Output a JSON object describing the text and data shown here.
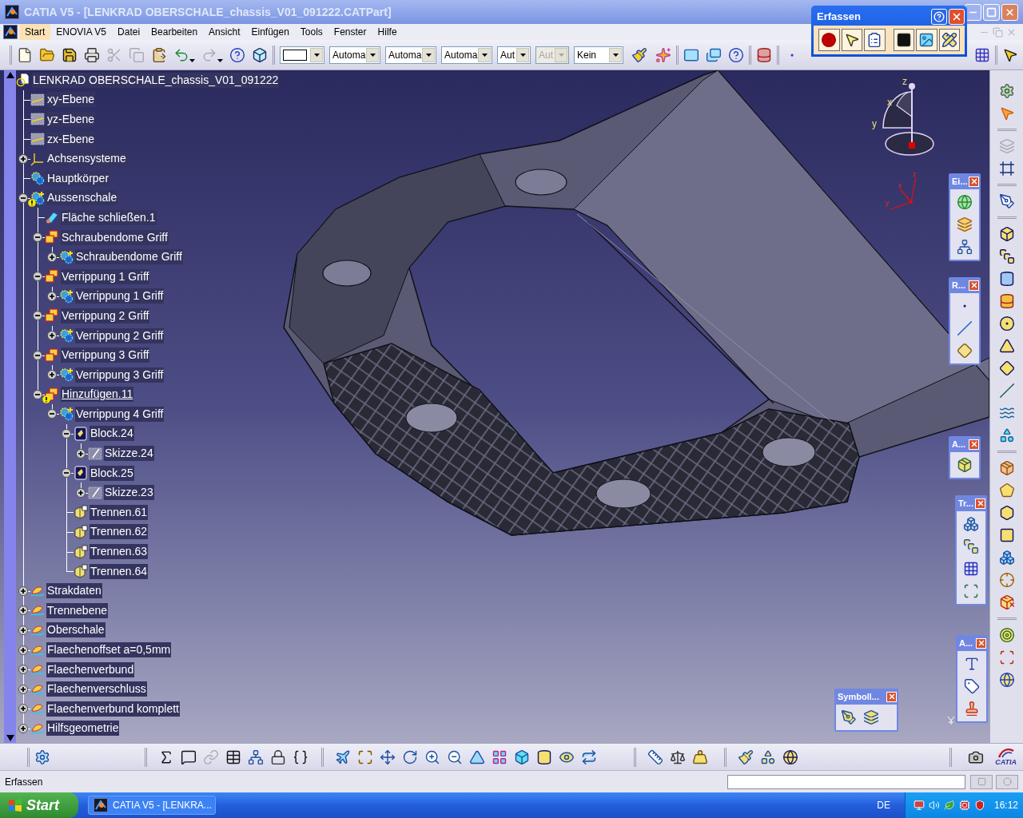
{
  "window": {
    "title": "CATIA V5 - [LENKRAD OBERSCHALE_chassis_V01_091222.CATPart]"
  },
  "menu": [
    {
      "label": "Start",
      "selected": true
    },
    {
      "label": "ENOVIA V5",
      "selected": false
    },
    {
      "label": "Datei",
      "selected": false
    },
    {
      "label": "Bearbeiten",
      "selected": false
    },
    {
      "label": "Ansicht",
      "selected": false
    },
    {
      "label": "Einfügen",
      "selected": false
    },
    {
      "label": "Tools",
      "selected": false
    },
    {
      "label": "Fenster",
      "selected": false
    },
    {
      "label": "Hilfe",
      "selected": false
    }
  ],
  "standard_toolbar": [
    {
      "disabled": false
    },
    {
      "disabled": false
    },
    {
      "disabled": false
    },
    {
      "disabled": false
    },
    {
      "disabled": true
    },
    {
      "disabled": true
    },
    {
      "disabled": false
    },
    {
      "disabled": false
    },
    {
      "disabled": true
    },
    {
      "disabled": false
    },
    {
      "disabled": false
    }
  ],
  "property_dropdowns": [
    {
      "value": "Automa",
      "disabled": false
    },
    {
      "value": "Automa",
      "disabled": false
    },
    {
      "value": "Automa",
      "disabled": false
    },
    {
      "value": "Aut",
      "disabled": false
    },
    {
      "value": "Aut",
      "disabled": true
    },
    {
      "value": "Kein",
      "disabled": false
    }
  ],
  "capture_toolbar": {
    "title": "Erfassen"
  },
  "tree": {
    "label": "LENKRAD OBERSCHALE_chassis_V01_091222",
    "kind": "part",
    "warning": false,
    "in_work": false,
    "children": [
      {
        "label": "xy-Ebene",
        "kind": "plane",
        "warning": false,
        "in_work": false
      },
      {
        "label": "yz-Ebene",
        "kind": "plane",
        "warning": false,
        "in_work": false
      },
      {
        "label": "zx-Ebene",
        "kind": "plane",
        "warning": false,
        "in_work": false
      },
      {
        "label": "Achsensysteme",
        "kind": "axes",
        "warning": false,
        "in_work": false,
        "expanded": false
      },
      {
        "label": "Hauptkörper",
        "kind": "main-body",
        "warning": false,
        "in_work": false
      },
      {
        "label": "Aussenschale",
        "kind": "body",
        "warning": true,
        "in_work": false,
        "expanded": true,
        "children": [
          {
            "label": "Fläche schließen.1",
            "kind": "surface",
            "warning": false,
            "in_work": false
          },
          {
            "label": "Schraubendome Griff",
            "kind": "operation",
            "warning": false,
            "in_work": false,
            "expanded": true,
            "children": [
              {
                "label": "Schraubendome Griff",
                "kind": "body",
                "warning": false,
                "in_work": false,
                "expanded": false
              }
            ]
          },
          {
            "label": "Verrippung 1 Griff",
            "kind": "operation",
            "warning": false,
            "in_work": false,
            "expanded": true,
            "children": [
              {
                "label": "Verrippung 1 Griff",
                "kind": "body",
                "warning": false,
                "in_work": false,
                "expanded": false
              }
            ]
          },
          {
            "label": "Verrippung 2 Griff",
            "kind": "operation",
            "warning": false,
            "in_work": false,
            "expanded": true,
            "children": [
              {
                "label": "Verrippung 2 Griff",
                "kind": "body",
                "warning": false,
                "in_work": false,
                "expanded": false
              }
            ]
          },
          {
            "label": "Verrippung 3 Griff",
            "kind": "operation",
            "warning": false,
            "in_work": false,
            "expanded": true,
            "children": [
              {
                "label": "Verrippung 3 Griff",
                "kind": "body",
                "warning": false,
                "in_work": false,
                "expanded": false
              }
            ]
          },
          {
            "label": "Hinzufügen.11",
            "kind": "operation",
            "warning": true,
            "in_work": true,
            "expanded": true,
            "children": [
              {
                "label": "Verrippung 4 Griff",
                "kind": "body",
                "warning": false,
                "in_work": false,
                "expanded": true,
                "children": [
                  {
                    "label": "Block.24",
                    "kind": "pad",
                    "warning": false,
                    "in_work": false,
                    "expanded": true,
                    "children": [
                      {
                        "label": "Skizze.24",
                        "kind": "sketch",
                        "warning": false,
                        "in_work": false,
                        "expanded": false
                      }
                    ]
                  },
                  {
                    "label": "Block.25",
                    "kind": "pad",
                    "warning": false,
                    "in_work": false,
                    "expanded": true,
                    "children": [
                      {
                        "label": "Skizze.23",
                        "kind": "sketch",
                        "warning": false,
                        "in_work": false,
                        "expanded": false
                      }
                    ]
                  },
                  {
                    "label": "Trennen.61",
                    "kind": "split",
                    "warning": false,
                    "in_work": false
                  },
                  {
                    "label": "Trennen.62",
                    "kind": "split",
                    "warning": false,
                    "in_work": false
                  },
                  {
                    "label": "Trennen.63",
                    "kind": "split",
                    "warning": false,
                    "in_work": false
                  },
                  {
                    "label": "Trennen.64",
                    "kind": "split",
                    "warning": false,
                    "in_work": false
                  }
                ]
              }
            ]
          }
        ]
      },
      {
        "label": "Strakdaten",
        "kind": "geoset",
        "warning": false,
        "in_work": false,
        "expanded": false
      },
      {
        "label": "Trennebene",
        "kind": "geoset",
        "warning": false,
        "in_work": false,
        "expanded": false
      },
      {
        "label": "Oberschale",
        "kind": "geoset",
        "warning": false,
        "in_work": false,
        "expanded": false
      },
      {
        "label": "Flaechenoffset a=0,5mm",
        "kind": "geoset",
        "warning": false,
        "in_work": false,
        "expanded": false
      },
      {
        "label": "Flaechenverbund",
        "kind": "geoset",
        "warning": false,
        "in_work": false,
        "expanded": false
      },
      {
        "label": "Flaechenverschluss",
        "kind": "geoset",
        "warning": false,
        "in_work": false,
        "expanded": false
      },
      {
        "label": "Flaechenverbund komplett",
        "kind": "geoset",
        "warning": false,
        "in_work": false,
        "expanded": false
      },
      {
        "label": "Hilfsgeometrie",
        "kind": "geoset",
        "warning": false,
        "in_work": false,
        "expanded": false
      }
    ]
  },
  "compass": {
    "labels": [
      "z",
      "x",
      "y"
    ]
  },
  "model_axes": {
    "labels": [
      "z",
      "x",
      "y"
    ]
  },
  "floating_toolbars": [
    {
      "title": "Ei..."
    },
    {
      "title": "R..."
    },
    {
      "title": "A..."
    },
    {
      "title": "Tr..."
    },
    {
      "title": "A..."
    },
    {
      "title": "Symboll..."
    }
  ],
  "part_design_toolbar": [
    {
      "disabled": false
    },
    {
      "disabled": false
    },
    {
      "disabled": true
    },
    {
      "disabled": false
    },
    {
      "disabled": false
    },
    {
      "disabled": false
    },
    {
      "disabled": false
    },
    {
      "disabled": false
    },
    {
      "disabled": false
    },
    {
      "disabled": false
    },
    {
      "disabled": false
    },
    {
      "disabled": false
    },
    {
      "disabled": false
    },
    {
      "disabled": false
    },
    {
      "disabled": false
    },
    {
      "disabled": false
    },
    {
      "disabled": false
    },
    {
      "disabled": false
    },
    {
      "disabled": false
    },
    {
      "disabled": false
    },
    {
      "disabled": false
    },
    {
      "disabled": false
    },
    {
      "disabled": false
    },
    {
      "disabled": false
    },
    {
      "disabled": false
    }
  ],
  "knowledge_toolbar": [
    {
      "disabled": false
    },
    {
      "disabled": false
    },
    {
      "disabled": true
    },
    {
      "disabled": false
    },
    {
      "disabled": false
    },
    {
      "disabled": false
    },
    {
      "disabled": false
    }
  ],
  "logo": {
    "label": "CATIA"
  },
  "status_bar": {
    "message": "Erfassen"
  },
  "taskbar": {
    "start": "Start",
    "tasks": [
      {
        "label": "CATIA V5 - [LENKRA...",
        "selected": false
      }
    ],
    "language": "DE",
    "clock": "16:12"
  }
}
